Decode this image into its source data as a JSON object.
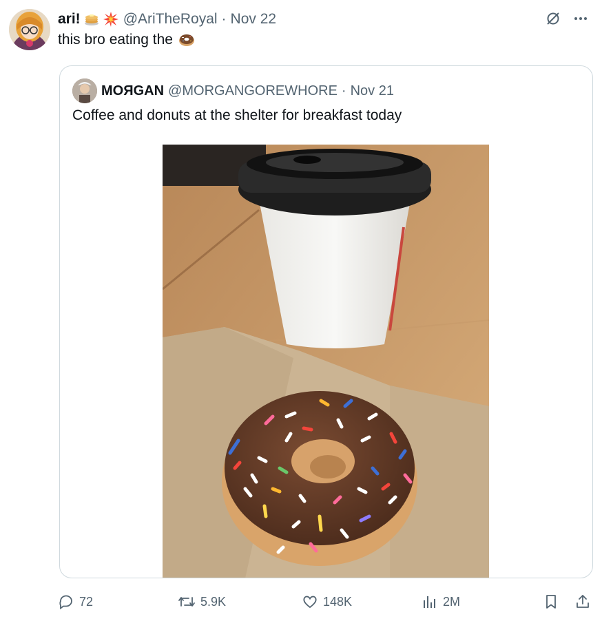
{
  "tweet": {
    "author_name": "ari!",
    "handle": "@AriTheRoyal",
    "separator": "·",
    "date": "Nov 22",
    "text": "this bro eating the",
    "emojis": [
      "pancake-emoji",
      "explosion-emoji"
    ],
    "text_emoji": "donut-emoji"
  },
  "quoted": {
    "author_name": "MOЯGAN",
    "handle": "@MORGANGOREWHORE",
    "separator": "·",
    "date": "Nov 21",
    "text": "Coffee and donuts at the shelter for breakfast today",
    "photo_subject": "coffee-cup-and-chocolate-sprinkle-donut"
  },
  "actions": {
    "replies": "72",
    "reposts": "5.9K",
    "likes": "148K",
    "views": "2M"
  },
  "icons": [
    "grok-icon",
    "more-icon",
    "reply-icon",
    "repost-icon",
    "like-icon",
    "views-icon",
    "bookmark-icon",
    "share-icon"
  ],
  "colors": {
    "text_primary": "#0f1419",
    "text_secondary": "#536471",
    "border": "#cfd9de"
  }
}
